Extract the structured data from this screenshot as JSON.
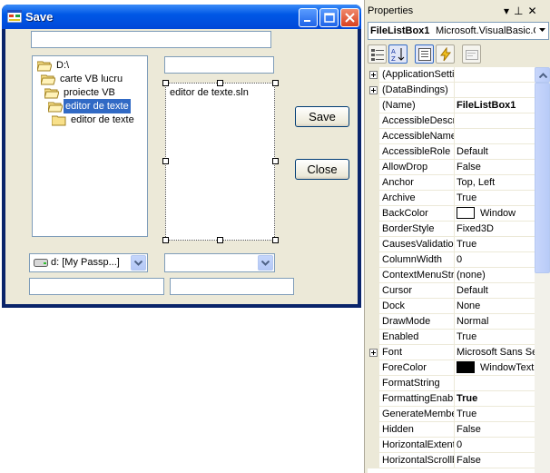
{
  "window": {
    "title": "Save"
  },
  "form": {
    "tree_items": [
      {
        "label": "D:\\",
        "selected": false
      },
      {
        "label": "carte VB lucru",
        "selected": false
      },
      {
        "label": "proiecte VB",
        "selected": false
      },
      {
        "label": "editor de texte",
        "selected": true
      },
      {
        "label": "editor de texte",
        "selected": false
      }
    ],
    "file_list_items": [
      "editor de texte.sln"
    ],
    "save_button": "Save",
    "close_button": "Close",
    "drive_combo_value": "d: [My Passp...]",
    "filter_combo_value": ""
  },
  "properties": {
    "panel_title": "Properties",
    "object_name": "FileListBox1",
    "object_type": "Microsoft.VisualBasic.C",
    "rows": [
      {
        "name": "(ApplicationSetti",
        "value": "",
        "expandable": true
      },
      {
        "name": "(DataBindings)",
        "value": "",
        "expandable": true
      },
      {
        "name": "(Name)",
        "value": "FileListBox1",
        "bold": true
      },
      {
        "name": "AccessibleDescri",
        "value": ""
      },
      {
        "name": "AccessibleName",
        "value": ""
      },
      {
        "name": "AccessibleRole",
        "value": "Default"
      },
      {
        "name": "AllowDrop",
        "value": "False"
      },
      {
        "name": "Anchor",
        "value": "Top, Left"
      },
      {
        "name": "Archive",
        "value": "True"
      },
      {
        "name": "BackColor",
        "value": "Window",
        "swatch": "#ffffff"
      },
      {
        "name": "BorderStyle",
        "value": "Fixed3D"
      },
      {
        "name": "CausesValidation",
        "value": "True"
      },
      {
        "name": "ColumnWidth",
        "value": "0"
      },
      {
        "name": "ContextMenuStr",
        "value": "(none)"
      },
      {
        "name": "Cursor",
        "value": "Default"
      },
      {
        "name": "Dock",
        "value": "None"
      },
      {
        "name": "DrawMode",
        "value": "Normal"
      },
      {
        "name": "Enabled",
        "value": "True"
      },
      {
        "name": "Font",
        "value": "Microsoft Sans Se",
        "expandable": true
      },
      {
        "name": "ForeColor",
        "value": "WindowText",
        "swatch": "#000000"
      },
      {
        "name": "FormatString",
        "value": ""
      },
      {
        "name": "FormattingEnabl",
        "value": "True",
        "bold": true
      },
      {
        "name": "GenerateMembe",
        "value": "True"
      },
      {
        "name": "Hidden",
        "value": "False"
      },
      {
        "name": "HorizontalExtent",
        "value": "0"
      },
      {
        "name": "HorizontalScrollb",
        "value": "False"
      }
    ]
  },
  "colors": {
    "title_bar": "#0058e6",
    "selection": "#316ac5",
    "dialog_bg": "#ece9d8"
  }
}
